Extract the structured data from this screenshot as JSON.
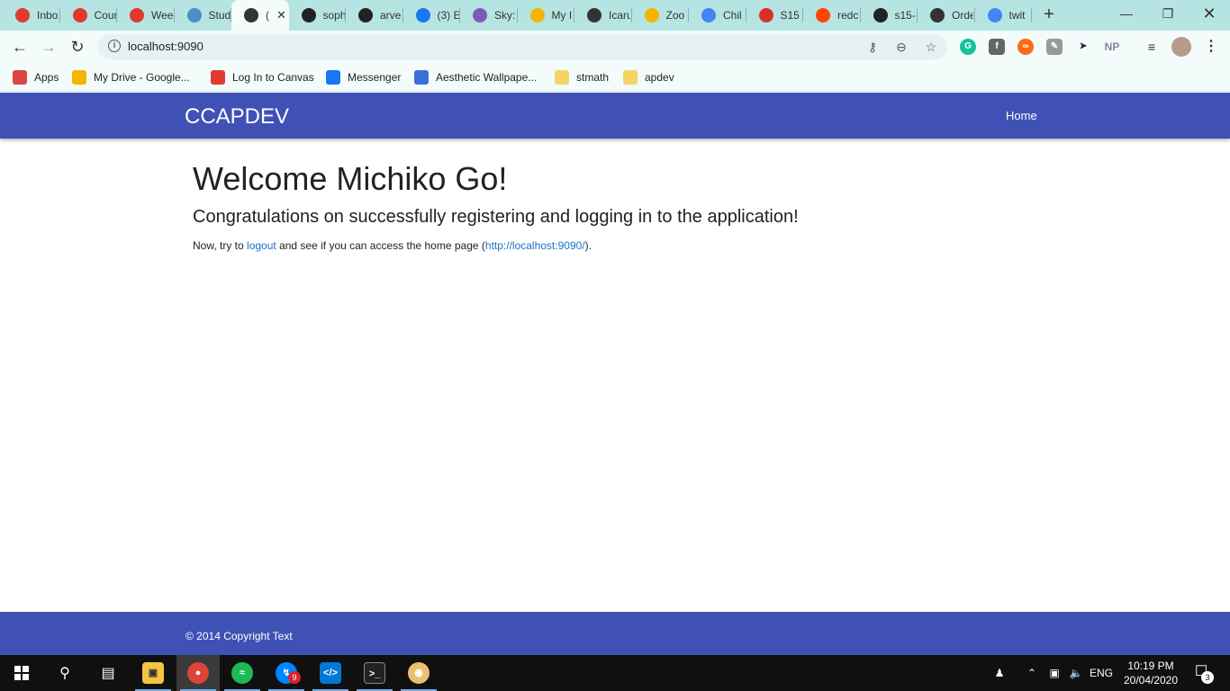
{
  "browser": {
    "tabs": [
      {
        "title": "Inbox",
        "icon": "canvas-icon",
        "color": "#e03a2e"
      },
      {
        "title": "Course",
        "icon": "canvas-icon",
        "color": "#e03a2e"
      },
      {
        "title": "Week",
        "icon": "canvas-icon",
        "color": "#e03a2e"
      },
      {
        "title": "Stud",
        "icon": "presentation-icon",
        "color": "#4a90c8"
      },
      {
        "title": "(",
        "icon": "globe-icon",
        "color": "#333333",
        "active": true
      },
      {
        "title": "soph",
        "icon": "github-icon",
        "color": "#222222"
      },
      {
        "title": "arve",
        "icon": "github-icon",
        "color": "#222222"
      },
      {
        "title": "(3) E",
        "icon": "facebook-icon",
        "color": "#1877f2"
      },
      {
        "title": "Sky:",
        "icon": "image-icon",
        "color": "#7b5bb8"
      },
      {
        "title": "My I",
        "icon": "drive-icon",
        "color": "#f4b400"
      },
      {
        "title": "Icaru",
        "icon": "globe-icon",
        "color": "#333333"
      },
      {
        "title": "Zoo",
        "icon": "drive-icon",
        "color": "#f4b400"
      },
      {
        "title": "Chil",
        "icon": "docs-icon",
        "color": "#4285f4"
      },
      {
        "title": "S15",
        "icon": "gmail-icon",
        "color": "#d93025"
      },
      {
        "title": "redc",
        "icon": "reddit-icon",
        "color": "#ff4500"
      },
      {
        "title": "s15-",
        "icon": "github-icon",
        "color": "#222222"
      },
      {
        "title": "Orde",
        "icon": "globe-icon",
        "color": "#333333"
      },
      {
        "title": "twit",
        "icon": "google-icon",
        "color": "#4285f4"
      }
    ],
    "url": "localhost:9090",
    "bookmarks": [
      {
        "label": "Apps",
        "icon": "apps-grid-icon",
        "color": "#d44"
      },
      {
        "label": "My Drive - Google...",
        "icon": "drive-icon",
        "color": "#f4b400"
      },
      {
        "label": "Log In to Canvas",
        "icon": "canvas-icon",
        "color": "#e03a2e"
      },
      {
        "label": "Messenger",
        "icon": "facebook-icon",
        "color": "#1877f2"
      },
      {
        "label": "Aesthetic Wallpape...",
        "icon": "wallpaper-icon",
        "color": "#3b6fd8"
      },
      {
        "label": "stmath",
        "icon": "folder-icon",
        "color": "#f6d365"
      },
      {
        "label": "apdev",
        "icon": "folder-icon",
        "color": "#f6d365"
      }
    ],
    "extensions": [
      "grammarly-icon",
      "facebook-ext-icon",
      "infinity-icon",
      "edit-icon",
      "cursor-icon",
      "np-icon",
      "media-icon",
      "profile-avatar"
    ]
  },
  "page": {
    "brand": "CCAPDEV",
    "nav_home": "Home",
    "heading": "Welcome Michiko Go!",
    "subheading": "Congratulations on successfully registering and logging in to the application!",
    "text_before": "Now, try to ",
    "logout_link": "logout",
    "text_middle": " and see if you can access the home page (",
    "home_link": "http://localhost:9090/",
    "text_after": ").",
    "footer": "© 2014 Copyright Text"
  },
  "taskbar": {
    "lang": "ENG",
    "time": "10:19 PM",
    "date": "20/04/2020",
    "messenger_badge": "9",
    "notification_count": "3"
  },
  "colors": {
    "primary": "#3f51b5",
    "link": "#1a73c8",
    "tabstrip": "#b6e4e2"
  }
}
